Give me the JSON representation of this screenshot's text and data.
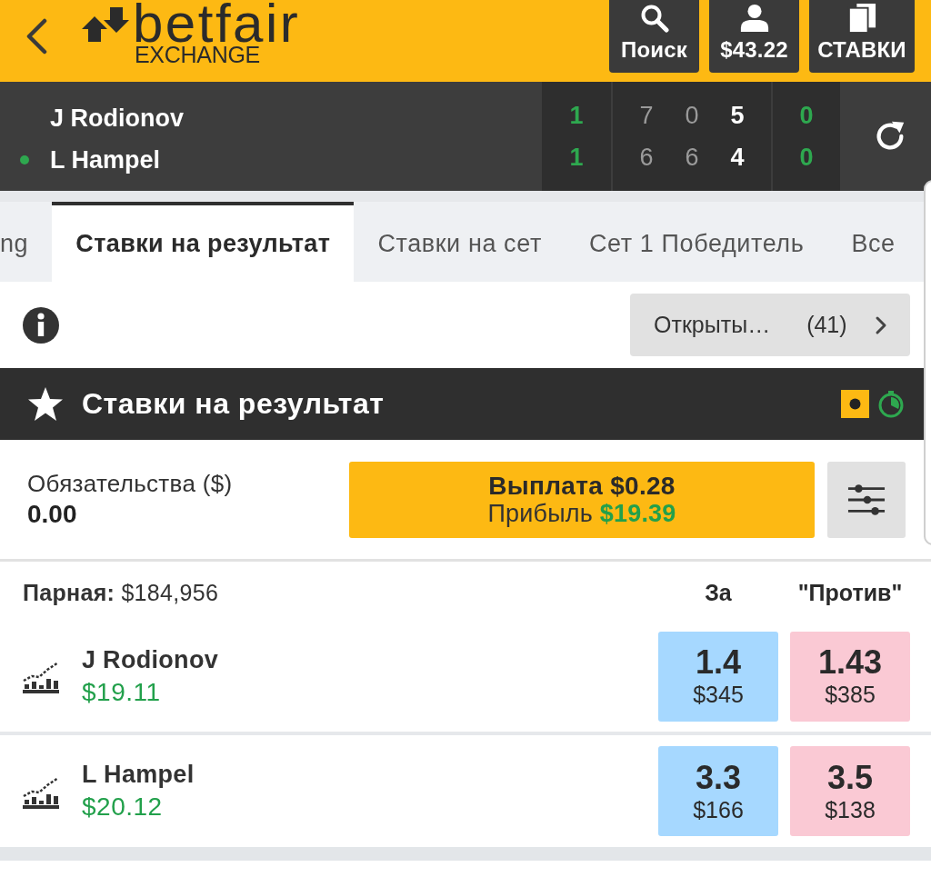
{
  "header": {
    "logo": {
      "brand": "betfair",
      "subtitle": "EXCHANGE"
    },
    "buttons": [
      {
        "kind": "search",
        "label": "Поиск"
      },
      {
        "kind": "account",
        "label": "$43.22"
      },
      {
        "kind": "bets",
        "label": "СТАВКИ"
      }
    ]
  },
  "scoreboard": {
    "players": [
      {
        "name": "J Rodionov",
        "serving": false,
        "sets": "1",
        "games": [
          "7",
          "0",
          "5"
        ],
        "points": "0"
      },
      {
        "name": "L Hampel",
        "serving": true,
        "sets": "1",
        "games": [
          "6",
          "6",
          "4"
        ],
        "points": "0"
      }
    ]
  },
  "tabs": [
    {
      "label": "ng",
      "selected": false
    },
    {
      "label": "Ставки на результат",
      "selected": true
    },
    {
      "label": "Ставки на сет",
      "selected": false
    },
    {
      "label": "Сет 1 Победитель",
      "selected": false
    },
    {
      "label": "Все",
      "selected": false
    }
  ],
  "open_bets": {
    "label": "Открыты…",
    "count": "(41)"
  },
  "market": {
    "title": "Ставки на результат",
    "liability": {
      "label": "Обязательства ($)",
      "value": "0.00"
    },
    "cash_out": {
      "title": "Выплата $0.28",
      "profit": "Прибыль **$19.39**"
    },
    "matched": "**Парная:** $184,956",
    "columns": [
      "За",
      "\"Против\""
    ],
    "runners": [
      {
        "name": "J Rodionov",
        "pnl": "$19.11",
        "back": {
          "odds": "1.4",
          "size": "$345"
        },
        "lay": {
          "odds": "1.43",
          "size": "$385"
        }
      },
      {
        "name": "L Hampel",
        "pnl": "$20.12",
        "back": {
          "odds": "3.3",
          "size": "$166"
        },
        "lay": {
          "odds": "3.5",
          "size": "$138"
        }
      }
    ]
  }
}
